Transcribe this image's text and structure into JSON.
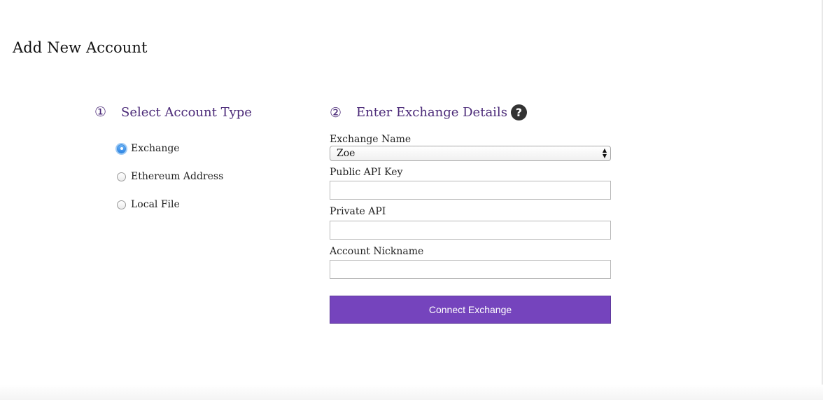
{
  "page": {
    "title": "Add New Account"
  },
  "step1": {
    "number": "①",
    "title": "Select Account Type",
    "options": [
      {
        "label": "Exchange",
        "checked": true
      },
      {
        "label": "Ethereum Address",
        "checked": false
      },
      {
        "label": "Local File",
        "checked": false
      }
    ]
  },
  "step2": {
    "number": "②",
    "title": "Enter Exchange Details",
    "help_icon": "question-circle-icon",
    "help_glyph": "?"
  },
  "form": {
    "exchange_name_label": "Exchange Name",
    "exchange_name_value": "Zoe",
    "public_api_key_label": "Public API Key",
    "public_api_key_value": "",
    "private_api_label": "Private API",
    "private_api_value": "",
    "account_nickname_label": "Account Nickname",
    "account_nickname_value": "",
    "submit_label": "Connect Exchange"
  },
  "colors": {
    "accent": "#7544bd",
    "heading": "#4b2a78",
    "radio_selected": "#2f86e6"
  }
}
